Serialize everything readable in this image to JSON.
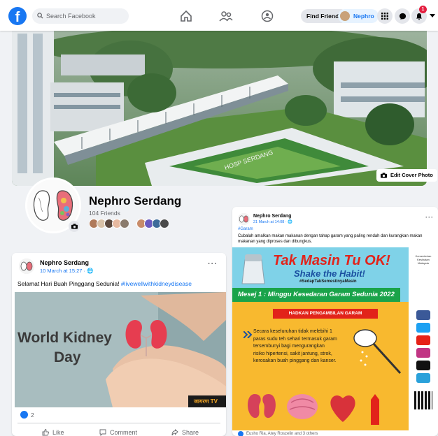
{
  "header": {
    "logo": "f",
    "search_placeholder": "Search Facebook",
    "find_friends": "Find Friends",
    "profile_chip": "Nephro",
    "notification_count": "1"
  },
  "cover": {
    "edit_label": "Edit Cover Photo",
    "sign_text": "HOSP SERDANG"
  },
  "profile": {
    "name": "Nephro Serdang",
    "friends": "104 Friends"
  },
  "post_left": {
    "author": "Nephro Serdang",
    "meta": "10 March at 15:27 · ",
    "text": "Selamat Hari Buah Pinggang Sedunia! ",
    "hashtag": "#livewellwithkidneydisease",
    "image_title_line1": "World Kidney",
    "image_title_line2": "Day",
    "watermark": "जागरण TV",
    "reaction_count": "2",
    "actions": {
      "like": "Like",
      "comment": "Comment",
      "share": "Share"
    }
  },
  "post_right": {
    "author": "Nephro Serdang",
    "meta": "21 March at 14:08 · ",
    "hashtag": "#Garam",
    "text": "Cubalah amalkan makan makanan dengan tahap garam yang paling rendah dan kurangkan makan makanan yang diproses dan dibungkus.",
    "poster": {
      "title": "Tak Masin Tu OK!",
      "subtitle": "Shake the Habit!",
      "tag": "#SedapTakSemestinyaMasin",
      "mesej": "Mesej 1 : Minggu Kesedaran Garam Sedunia 2022",
      "banner": "HADKAN PENGAMBILAN GARAM",
      "body": "Secara keseluruhan tidak melebihi 1 paras sudu teh sehari termasuk garam tersembunyi bagi mengurangkan risiko hipertensi, sakit jantung, strok, kerosakan buah pinggang dan kanser.",
      "side_label": "Kementerian Kesihatan Malaysia"
    },
    "reactions_text": "Eusho Ria, Atey Roszelin and 3 others"
  },
  "colors": {
    "brand": "#1877f2",
    "poster_bg": "#f8b92f",
    "poster_header": "#1aa34a",
    "banner": "#e2231a"
  }
}
